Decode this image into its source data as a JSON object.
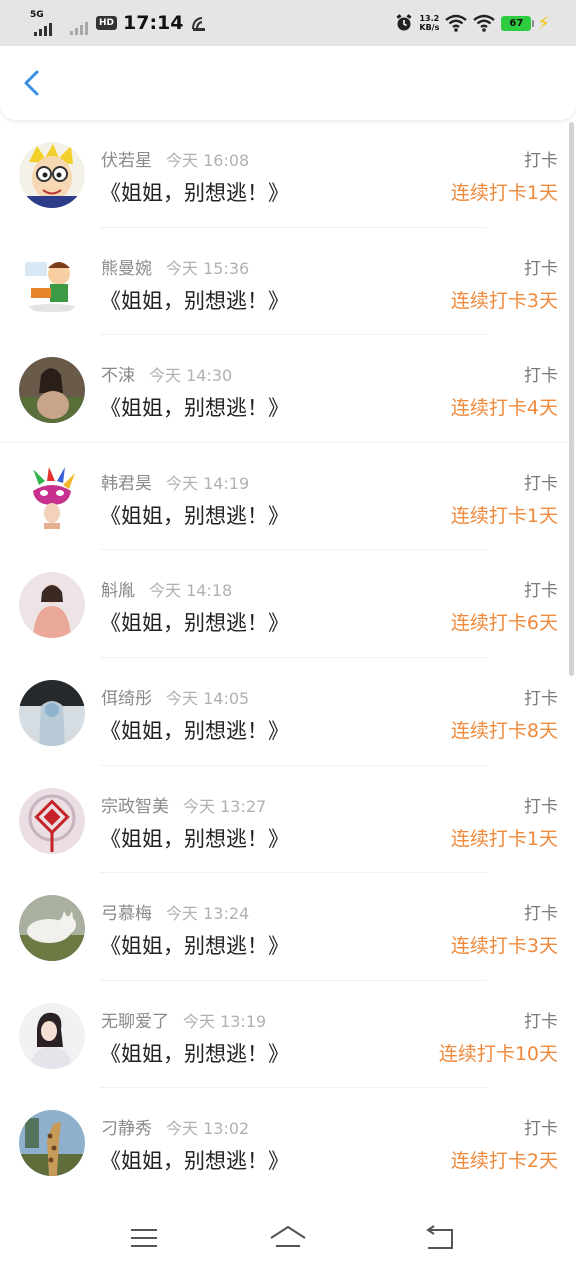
{
  "status_bar": {
    "network": "5G",
    "hd_label": "HD",
    "time": "17:14",
    "speed_value": "13.2",
    "speed_unit": "KB/s",
    "battery": "67"
  },
  "header": {
    "back_icon": "chevron-left-icon",
    "accent_color": "#3a8ee6"
  },
  "list": {
    "items": [
      {
        "name": "伏若星",
        "time": "今天 16:08",
        "book": "《姐姐，别想逃！》",
        "action": "打卡",
        "streak": "连续打卡1天"
      },
      {
        "name": "熊曼婉",
        "time": "今天 15:36",
        "book": "《姐姐，别想逃！》",
        "action": "打卡",
        "streak": "连续打卡3天"
      },
      {
        "name": "不涑",
        "time": "今天 14:30",
        "book": "《姐姐，别想逃！》",
        "action": "打卡",
        "streak": "连续打卡4天"
      },
      {
        "name": "韩君昊",
        "time": "今天 14:19",
        "book": "《姐姐，别想逃！》",
        "action": "打卡",
        "streak": "连续打卡1天"
      },
      {
        "name": "斛胤",
        "time": "今天 14:18",
        "book": "《姐姐，别想逃！》",
        "action": "打卡",
        "streak": "连续打卡6天"
      },
      {
        "name": "佴绮彤",
        "time": "今天 14:05",
        "book": "《姐姐，别想逃！》",
        "action": "打卡",
        "streak": "连续打卡8天"
      },
      {
        "name": "宗政智美",
        "time": "今天 13:27",
        "book": "《姐姐，别想逃！》",
        "action": "打卡",
        "streak": "连续打卡1天"
      },
      {
        "name": "弓慕梅",
        "time": "今天 13:24",
        "book": "《姐姐，别想逃！》",
        "action": "打卡",
        "streak": "连续打卡3天"
      },
      {
        "name": "无聊爱了",
        "time": "今天 13:19",
        "book": "《姐姐，别想逃！》",
        "action": "打卡",
        "streak": "连续打卡10天"
      },
      {
        "name": "刁静秀",
        "time": "今天 13:02",
        "book": "《姐姐，别想逃！》",
        "action": "打卡",
        "streak": "连续打卡2天"
      }
    ]
  },
  "colors": {
    "streak": "#f08a3c",
    "name": "#8a8a8a",
    "timestamp": "#b1b1b1"
  },
  "nav_bar": {
    "icons": [
      "menu-icon",
      "home-icon",
      "back-icon"
    ]
  }
}
